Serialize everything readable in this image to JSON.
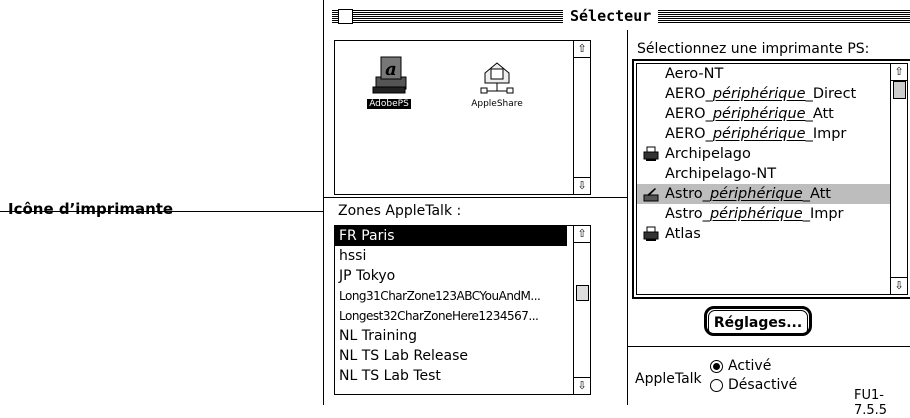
{
  "callout": {
    "label": "Icône d’imprimante"
  },
  "window": {
    "title": "Sélecteur"
  },
  "drivers": [
    {
      "label": "AdobePS",
      "icon": "adobeps-driver-icon",
      "selected": true
    },
    {
      "label": "AppleShare",
      "icon": "appleshare-driver-icon",
      "selected": false
    }
  ],
  "zones": {
    "label": "Zones AppleTalk :",
    "items": [
      {
        "text": "FR Paris",
        "selected": true
      },
      {
        "text": "hssi"
      },
      {
        "text": "JP Tokyo"
      },
      {
        "text": "Long31CharZone123ABCYouAndM..."
      },
      {
        "text": "Longest32CharZoneHere1234567..."
      },
      {
        "text": "NL Training"
      },
      {
        "text": "NL TS Lab Release"
      },
      {
        "text": "NL TS Lab Test"
      }
    ]
  },
  "printers": {
    "label": "Sélectionnez une imprimante PS:",
    "items": [
      {
        "pre": "Aero-NT",
        "em": "",
        "post": "",
        "icon": ""
      },
      {
        "pre": "AERO_",
        "em": "périphérique",
        "post": "_Direct",
        "icon": ""
      },
      {
        "pre": "AERO_",
        "em": "périphérique",
        "post": "_Att",
        "icon": ""
      },
      {
        "pre": "AERO_",
        "em": "périphérique",
        "post": "_Impr",
        "icon": ""
      },
      {
        "pre": "Archipelago",
        "em": "",
        "post": "",
        "icon": "printer-icon"
      },
      {
        "pre": "Archipelago-NT",
        "em": "",
        "post": "",
        "icon": ""
      },
      {
        "pre": "Astro_",
        "em": "périphérique",
        "post": "_Att",
        "icon": "printer-pen-icon",
        "selected": true
      },
      {
        "pre": "Astro_",
        "em": "périphérique",
        "post": "_Impr",
        "icon": ""
      },
      {
        "pre": "Atlas",
        "em": "",
        "post": "",
        "icon": "printer-icon"
      }
    ]
  },
  "setup_button": "Réglages...",
  "appletalk": {
    "label": "AppleTalk",
    "options": [
      {
        "text": "Activé",
        "checked": true
      },
      {
        "text": "Désactivé",
        "checked": false
      }
    ]
  },
  "figure_id": "FU1-7.5.5"
}
